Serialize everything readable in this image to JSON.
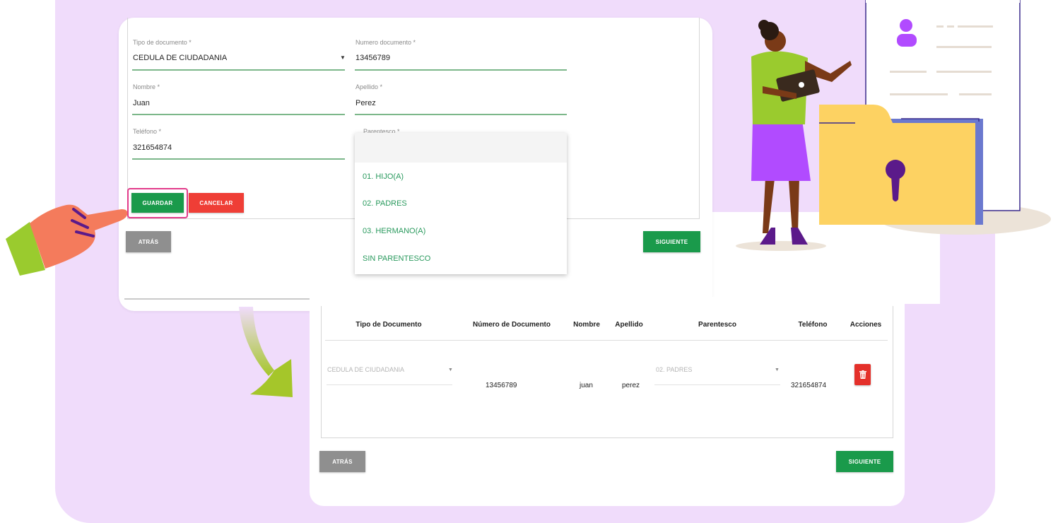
{
  "form": {
    "tipo_documento": {
      "label": "Tipo de documento *",
      "value": "CEDULA DE CIUDADANIA"
    },
    "numero_documento": {
      "label": "Numero documento *",
      "value": "13456789"
    },
    "nombre": {
      "label": "Nombre *",
      "value": "Juan"
    },
    "apellido": {
      "label": "Apellido *",
      "value": "Perez"
    },
    "telefono": {
      "label": "Teléfono *",
      "value": "321654874"
    },
    "parentesco": {
      "label": "Parentesco *",
      "options": [
        "01. HIJO(A)",
        "02. PADRES",
        "03. HERMANO(A)",
        "SIN PARENTESCO"
      ]
    },
    "guardar_label": "GUARDAR",
    "cancelar_label": "CANCELAR"
  },
  "nav_top": {
    "atras_label": "ATRÁS",
    "siguiente_label": "SIGUIENTE"
  },
  "table": {
    "headers": [
      "Tipo de Documento",
      "Número de Documento",
      "Nombre",
      "Apellido",
      "Parentesco",
      "Teléfono",
      "Acciones"
    ],
    "row": {
      "tipo_documento": "CEDULA DE CIUDADANIA",
      "numero_documento": "13456789",
      "nombre": "juan",
      "apellido": "perez",
      "parentesco": "02. PADRES",
      "telefono": "321654874"
    }
  },
  "nav_bottom": {
    "atras_label": "ATRÁS",
    "siguiente_label": "SIGUIENTE"
  },
  "colors": {
    "background_panel": "#f0dcfb",
    "primary_green": "#1a9a4b",
    "danger_red": "#ef3e36",
    "highlight_pink": "#e23b8a",
    "input_line": "#7cb78a"
  },
  "icons": {
    "dropdown_arrow": "caret-down-icon",
    "delete": "trash-icon",
    "pointer": "pointing-hand-icon",
    "flow": "curved-arrow-icon"
  }
}
